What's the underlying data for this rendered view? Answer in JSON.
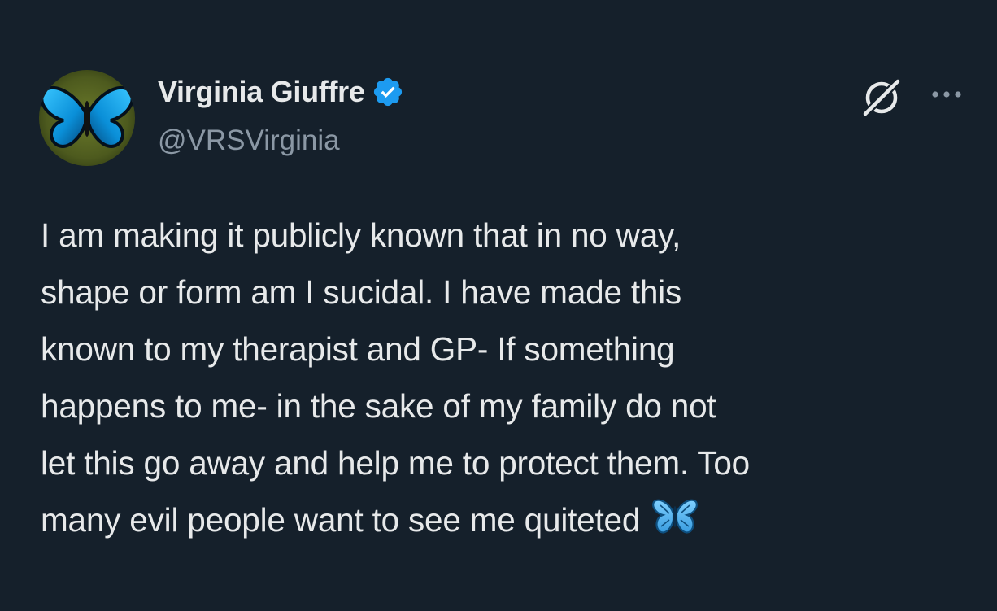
{
  "post": {
    "author": {
      "display_name": "Virginia Giuffre",
      "handle": "@VRSVirginia",
      "verified": true,
      "avatar_icon": "butterfly-avatar-icon"
    },
    "actions": {
      "grok_icon": "grok-icon",
      "more_icon": "more-options-icon"
    },
    "text_lines": [
      "I am making it publicly known that in no way,",
      "shape or form am I sucidal. I have made this",
      "known to my therapist and GP- If something",
      "happens to me- in the sake of my family do not",
      "let this go away and help me to protect them. Too",
      "many evil people want to see me quiteted"
    ],
    "trailing_emoji": "🦋"
  },
  "colors": {
    "background": "#15202b",
    "verified_blue": "#1d9bf0",
    "handle_gray": "#8b98a5",
    "text": "#e7e9ea"
  }
}
